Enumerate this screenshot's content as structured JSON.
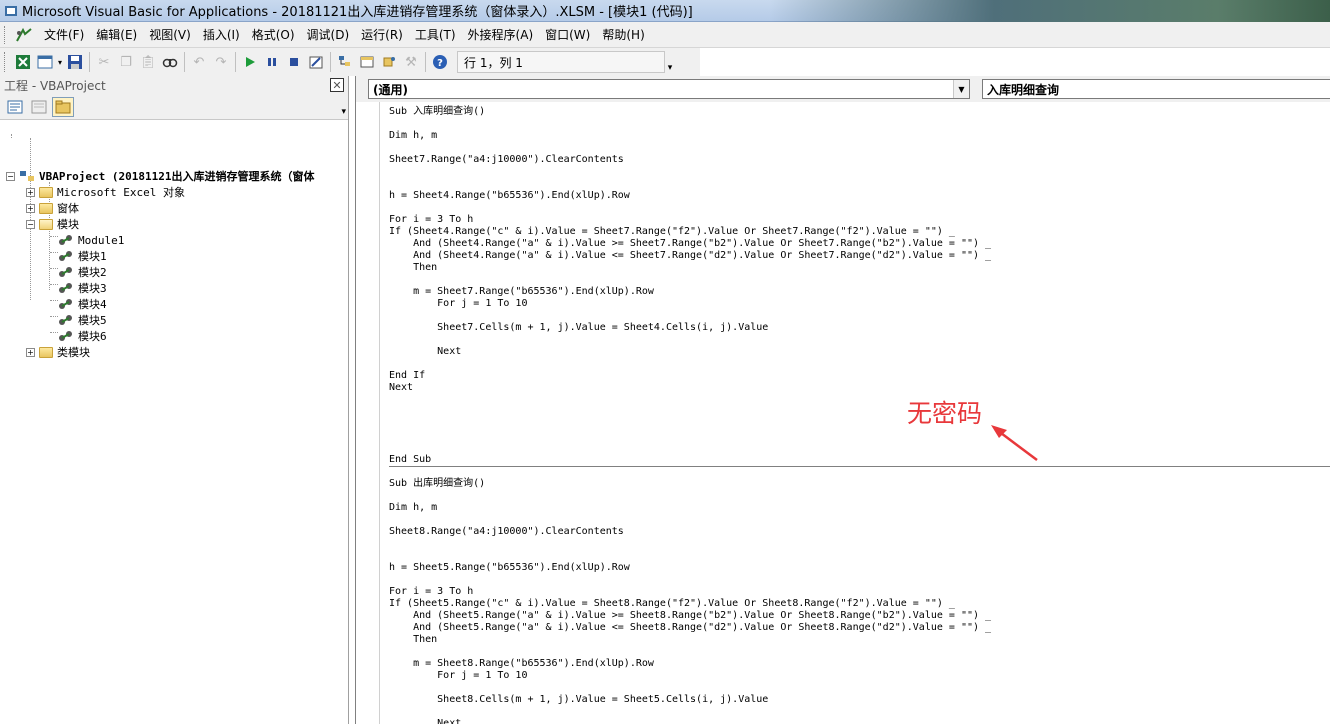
{
  "window": {
    "title": "Microsoft Visual Basic for Applications - 20181121出入库进销存管理系统（窗体录入）.XLSM - [模块1 (代码)]"
  },
  "menu": {
    "items": [
      "文件(F)",
      "编辑(E)",
      "视图(V)",
      "插入(I)",
      "格式(O)",
      "调试(D)",
      "运行(R)",
      "工具(T)",
      "外接程序(A)",
      "窗口(W)",
      "帮助(H)"
    ]
  },
  "toolbar": {
    "position": "行 1，列 1"
  },
  "project": {
    "title": "工程 - VBAProject",
    "root": "VBAProject (20181121出入库进销存管理系统（窗体",
    "excel_objects": "Microsoft Excel 对象",
    "forms": "窗体",
    "modules_folder": "模块",
    "modules": [
      "Module1",
      "模块1",
      "模块2",
      "模块3",
      "模块4",
      "模块5",
      "模块6"
    ],
    "class_modules": "类模块"
  },
  "code_window": {
    "object_combo": "(通用)",
    "proc_combo": "入库明细查询"
  },
  "code": {
    "proc1": [
      "Sub 入库明细查询()",
      "",
      "Dim h, m",
      "",
      "Sheet7.Range(\"a4:j10000\").ClearContents",
      "",
      "",
      "h = Sheet4.Range(\"b65536\").End(xlUp).Row",
      "",
      "For i = 3 To h",
      "If (Sheet4.Range(\"c\" & i).Value = Sheet7.Range(\"f2\").Value Or Sheet7.Range(\"f2\").Value = \"\") _",
      "    And (Sheet4.Range(\"a\" & i).Value >= Sheet7.Range(\"b2\").Value Or Sheet7.Range(\"b2\").Value = \"\") _",
      "    And (Sheet4.Range(\"a\" & i).Value <= Sheet7.Range(\"d2\").Value Or Sheet7.Range(\"d2\").Value = \"\") _",
      "    Then",
      "",
      "    m = Sheet7.Range(\"b65536\").End(xlUp).Row",
      "        For j = 1 To 10",
      "",
      "        Sheet7.Cells(m + 1, j).Value = Sheet4.Cells(i, j).Value",
      "",
      "        Next",
      "",
      "End If",
      "Next",
      "",
      "",
      "",
      "",
      "",
      "End Sub"
    ],
    "proc2": [
      "Sub 出库明细查询()",
      "",
      "Dim h, m",
      "",
      "Sheet8.Range(\"a4:j10000\").ClearContents",
      "",
      "",
      "h = Sheet5.Range(\"b65536\").End(xlUp).Row",
      "",
      "For i = 3 To h",
      "If (Sheet5.Range(\"c\" & i).Value = Sheet8.Range(\"f2\").Value Or Sheet8.Range(\"f2\").Value = \"\") _",
      "    And (Sheet5.Range(\"a\" & i).Value >= Sheet8.Range(\"b2\").Value Or Sheet8.Range(\"b2\").Value = \"\") _",
      "    And (Sheet5.Range(\"a\" & i).Value <= Sheet8.Range(\"d2\").Value Or Sheet8.Range(\"d2\").Value = \"\") _",
      "    Then",
      "",
      "    m = Sheet8.Range(\"b65536\").End(xlUp).Row",
      "        For j = 1 To 10",
      "",
      "        Sheet8.Cells(m + 1, j).Value = Sheet5.Cells(i, j).Value",
      "",
      "        Next"
    ]
  },
  "annotation": {
    "text": "无密码",
    "color": "#e8383b"
  }
}
